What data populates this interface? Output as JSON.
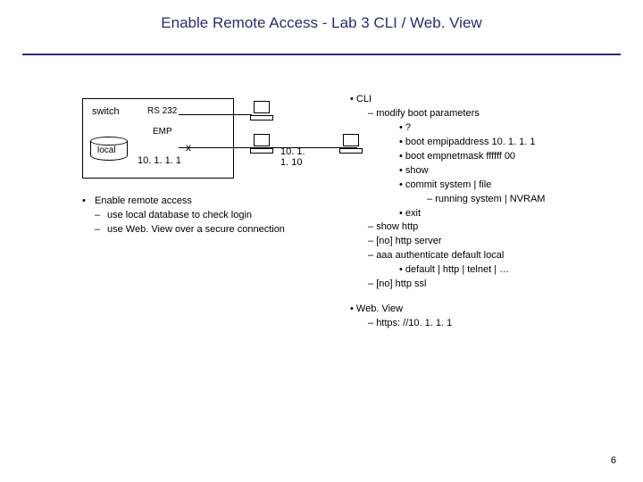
{
  "title": "Enable Remote Access - Lab 3 CLI / Web. View",
  "diagram": {
    "switch": "switch",
    "rs232": "RS 232",
    "emp": "EMP",
    "local": "local",
    "ip1": "10. 1. 1. 1",
    "x": "x",
    "ip2": "10. 1. 1. 10"
  },
  "left": {
    "l0": "Enable remote access",
    "l1": "use local database to check login",
    "l2": "use Web. View over a secure connection"
  },
  "right": {
    "cli": "CLI",
    "r1": "modify boot parameters",
    "r1a": "?",
    "r1b": "boot empipaddress 10. 1. 1. 1",
    "r1c": "boot empnetmask ffffff 00",
    "r1d": "show",
    "r1e": "commit system | file",
    "r1e1": "running system | NVRAM",
    "r1f": "exit",
    "r2": "show http",
    "r3": "[no] http server",
    "r4": "aaa authenticate default local",
    "r4a": "default | http | telnet | …",
    "r5": "[no] http ssl",
    "wv": "Web. View",
    "wv1": "https: //10. 1. 1. 1"
  },
  "slidenum": "6"
}
